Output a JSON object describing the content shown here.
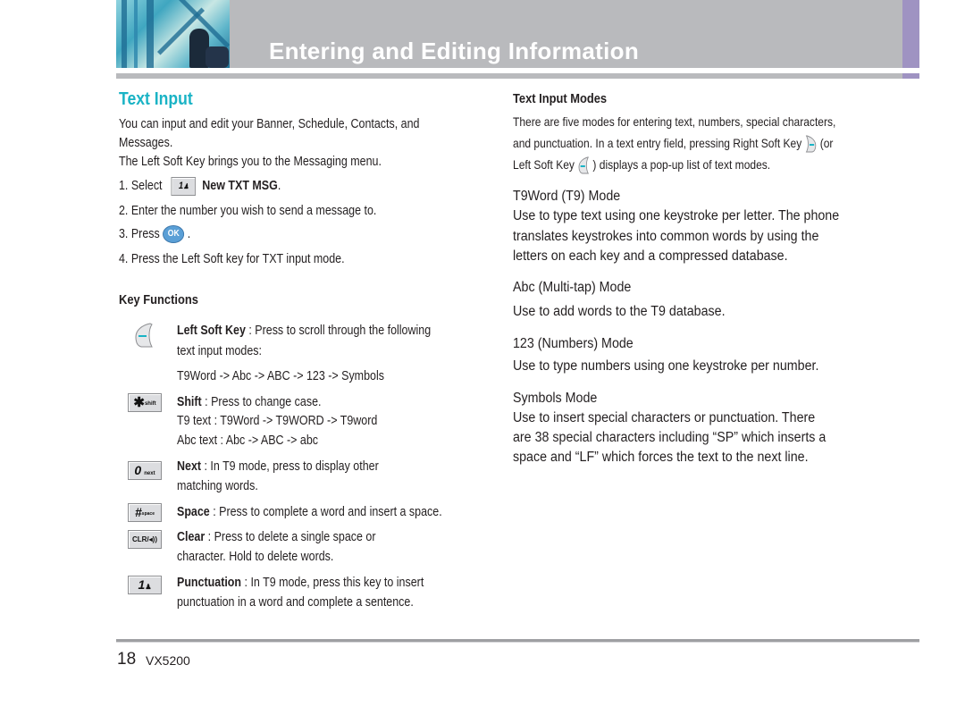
{
  "header": {
    "title": "Entering and Editing Information",
    "colors": {
      "bar": "#b9babd",
      "accent": "#9f93c2",
      "title": "#ffffff"
    }
  },
  "left": {
    "section_title": "Text Input",
    "section_title_color": "#1ab3c5",
    "intro_line1": "You can input and edit your Banner, Schedule, Contacts, and",
    "intro_line2": "Messages.",
    "intro_line3": "The Left Soft Key brings you to the Messaging menu.",
    "step1_prefix": "1. Select",
    "step1_key": "1",
    "step1_bold": "New TXT MSG",
    "step1_suffix": ".",
    "step2": "2. Enter the number you wish to send a message to.",
    "step3_prefix": "3. Press",
    "step3_key": "OK",
    "step3_suffix": ".",
    "step4": "4. Press the Left Soft key for TXT input mode.",
    "key_functions_title": "Key Functions",
    "key_functions": [
      {
        "icon": "left-soft-key-icon",
        "name": "Left Soft Key",
        "line1": " : Press to scroll through the following",
        "line2": "text input modes:",
        "line3": "T9Word -> Abc -> ABC  -> 123 -> Symbols"
      },
      {
        "icon": "star-shift-key-icon",
        "key": "*",
        "key_sub": "shift",
        "name": "Shift",
        "line1": " : Press to change case.",
        "line2": "T9 text : T9Word -> T9WORD -> T9word",
        "line3": "Abc text : Abc -> ABC -> abc"
      },
      {
        "icon": "zero-next-key-icon",
        "key": "0",
        "key_sub": "next",
        "name": "Next",
        "line1": " : In T9 mode, press to display other",
        "line2": "matching words."
      },
      {
        "icon": "pound-space-key-icon",
        "key": "#",
        "key_sub": "space",
        "name": "Space",
        "line1": " : Press to complete a word and insert a space."
      },
      {
        "icon": "clear-key-icon",
        "key": "CLR/◂))",
        "name": "Clear",
        "line1": " : Press to delete a single space or",
        "line2": "character. Hold to delete words."
      },
      {
        "icon": "one-key-icon",
        "key": "1",
        "name": "Punctuation",
        "line1": " : In T9 mode, press this key to insert",
        "line2": "punctuation in a word and complete a sentence."
      }
    ]
  },
  "right": {
    "title": "Text Input Modes",
    "intro_line1": "There are five modes for entering text, numbers, special characters,",
    "intro_line2a": "and punctuation. In a text entry field, pressing Right Soft Key",
    "intro_line2b": "(or",
    "intro_line3a": "Left Soft Key",
    "intro_line3b": ") displays a pop-up list of text modes.",
    "modes": [
      {
        "title": "T9Word (T9) Mode",
        "lines": [
          "Use to type text using one keystroke per letter. The phone",
          "translates keystrokes into common words by using the",
          "letters on each key and a compressed database."
        ]
      },
      {
        "title": "Abc (Multi-tap) Mode",
        "lines": [
          "Use to add words to the T9 database."
        ]
      },
      {
        "title": "123 (Numbers) Mode",
        "lines": [
          "Use to type numbers using one keystroke per number."
        ]
      },
      {
        "title": "Symbols Mode",
        "lines": [
          "Use to insert special characters or punctuation. There",
          "are 38 special characters including “SP” which inserts a",
          "space and “LF” which forces the text to the next line."
        ]
      }
    ]
  },
  "footer": {
    "page_number": "18",
    "model": "VX5200"
  }
}
